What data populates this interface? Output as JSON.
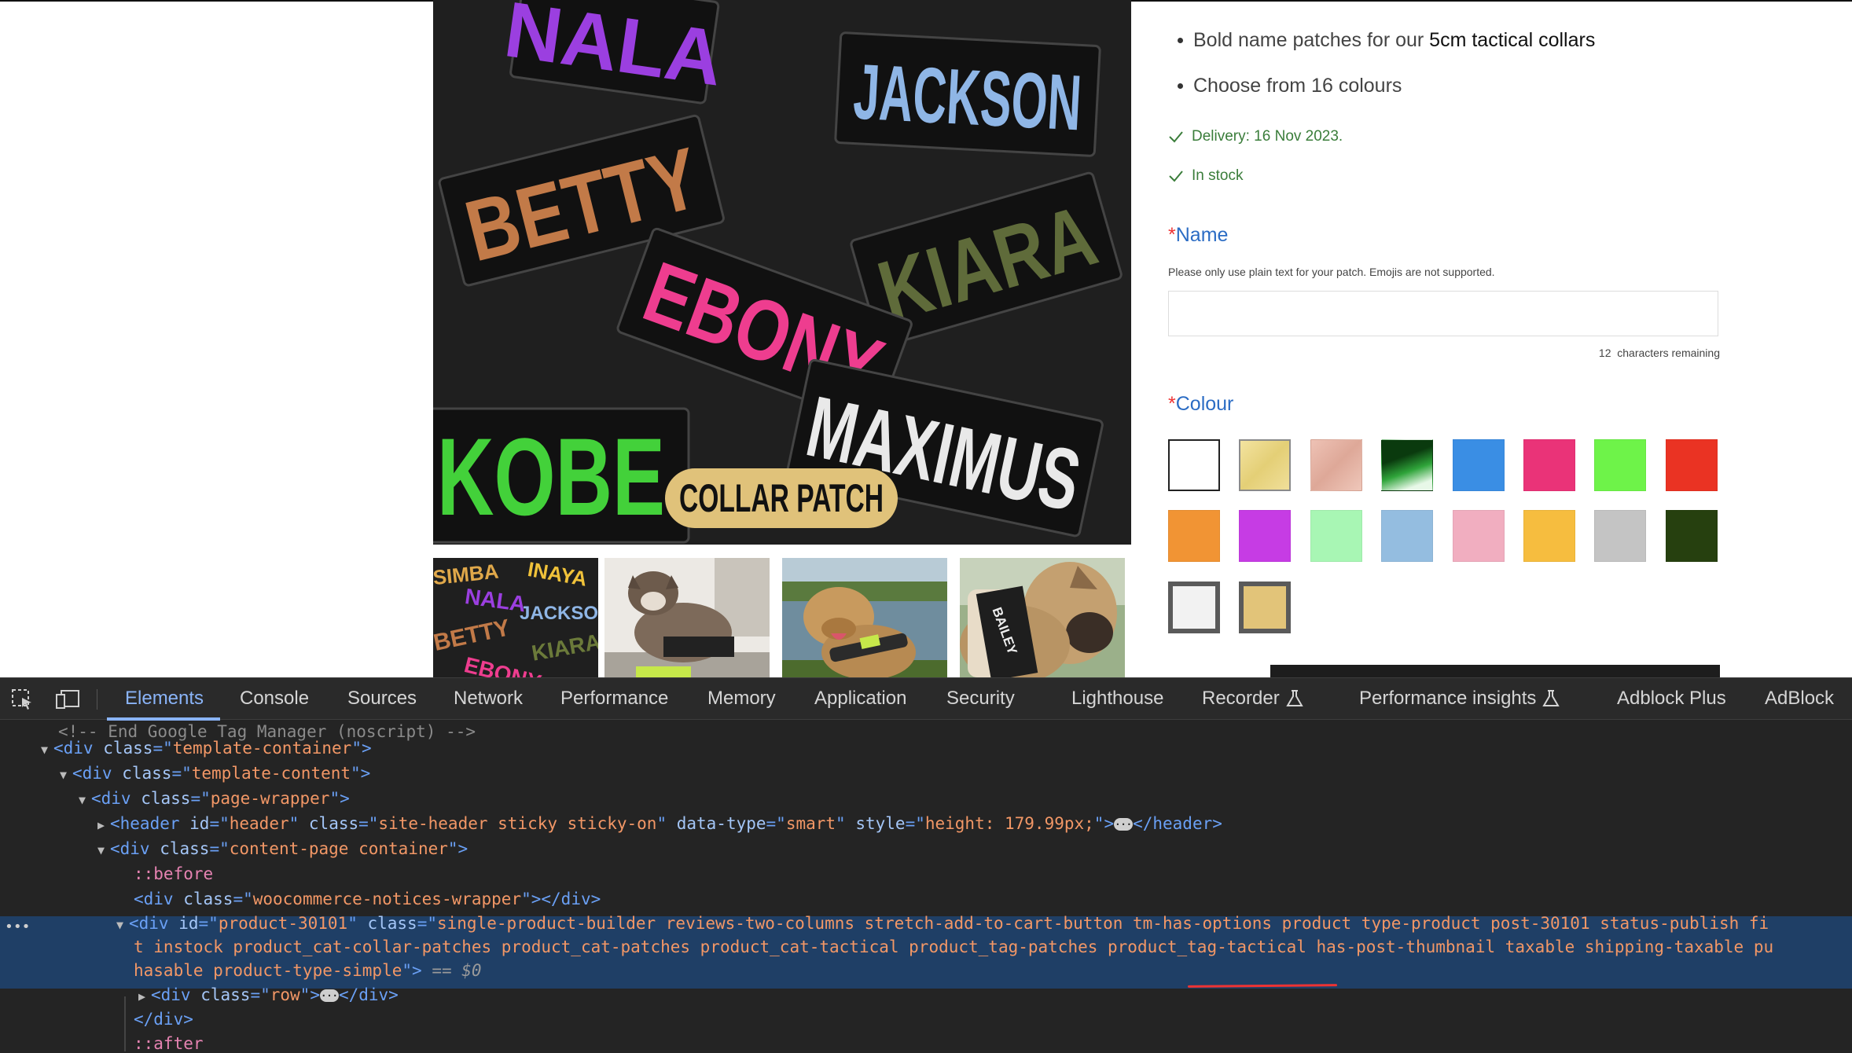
{
  "product": {
    "image": {
      "names": [
        "NALA",
        "JACKSON",
        "BETTY",
        "KIARA",
        "EBONY",
        "KOBE",
        "MAXIMUS"
      ],
      "badge": "COLLAR PATCH",
      "name_colors": {
        "NALA": "#9b3fe0",
        "JACKSON": "#8fb6e6",
        "BETTY": "#c27a48",
        "KIARA": "#5f6b3a",
        "EBONY": "#ee3d8f",
        "KOBE": "#43d13a",
        "MAXIMUS": "#e9e9e9"
      },
      "badge_color": "#e0c27a"
    },
    "thumbnails": [
      {
        "alt": "patch collage",
        "words": [
          "SIMBA",
          "INAYA",
          "NALA",
          "JACKSON",
          "BETTY",
          "KIARA",
          "EBONY"
        ]
      },
      {
        "alt": "dog in harness"
      },
      {
        "alt": "dog at lake with collar"
      },
      {
        "alt": "dog with named collar",
        "word": "BAILEY"
      }
    ]
  },
  "info": {
    "bullets": [
      {
        "prefix": "Bold name patches for our ",
        "strong": "5cm tactical collars"
      },
      {
        "prefix": "Choose from 16 colours",
        "strong": ""
      }
    ],
    "delivery": "Delivery: 16 Nov 2023.",
    "stock": "In stock",
    "name_field": {
      "required_mark": "*",
      "label": "Name",
      "hint": "Please only use plain text for your patch. Emojis are not supported.",
      "value": "",
      "remaining_count": "12",
      "remaining_text": "characters remaining"
    },
    "colour_field": {
      "required_mark": "*",
      "label": "Colour",
      "swatches": [
        {
          "name": "white",
          "color": "#ffffff",
          "selected": false
        },
        {
          "name": "gold",
          "color": "#ecd889",
          "selected": true
        },
        {
          "name": "rose-gold",
          "color": "#e8b7a8",
          "selected": false
        },
        {
          "name": "green-gradient",
          "color": "#0f4d14",
          "selected": false
        },
        {
          "name": "blue",
          "color": "#3a8ee4",
          "selected": false
        },
        {
          "name": "pink",
          "color": "#ea3378",
          "selected": false
        },
        {
          "name": "lime",
          "color": "#6ef349",
          "selected": false
        },
        {
          "name": "red",
          "color": "#ea3323",
          "selected": false
        },
        {
          "name": "orange",
          "color": "#f19434",
          "selected": false
        },
        {
          "name": "purple",
          "color": "#c63ce4",
          "selected": false
        },
        {
          "name": "mint",
          "color": "#a8f6b4",
          "selected": false
        },
        {
          "name": "light-blue",
          "color": "#94bde0",
          "selected": false
        },
        {
          "name": "light-pink",
          "color": "#f1aec0",
          "selected": false
        },
        {
          "name": "yellow",
          "color": "#f6bd3f",
          "selected": false
        },
        {
          "name": "grey",
          "color": "#c4c4c4",
          "selected": false
        },
        {
          "name": "dark-green",
          "color": "#26400f",
          "selected": false
        },
        {
          "name": "reflective-white",
          "color": "#f2f2f2",
          "selected": false
        },
        {
          "name": "reflective-gold",
          "color": "#e2c479",
          "selected": false
        }
      ]
    }
  },
  "devtools": {
    "tabs": [
      {
        "label": "Elements",
        "active": true
      },
      {
        "label": "Console",
        "active": false
      },
      {
        "label": "Sources",
        "active": false
      },
      {
        "label": "Network",
        "active": false
      },
      {
        "label": "Performance",
        "active": false
      },
      {
        "label": "Memory",
        "active": false
      },
      {
        "label": "Application",
        "active": false
      },
      {
        "label": "Security",
        "active": false
      },
      {
        "label": "Lighthouse",
        "active": false
      },
      {
        "label": "Recorder",
        "active": false,
        "flask": true
      },
      {
        "label": "Performance insights",
        "active": false,
        "flask": true
      },
      {
        "label": "Adblock Plus",
        "active": false
      },
      {
        "label": "AdBlock",
        "active": false
      }
    ],
    "tree": {
      "comment": "<!-- End Google Tag Manager (noscript) -->",
      "template_container_class": "template-container",
      "template_content_class": "template-content",
      "page_wrapper_class": "page-wrapper",
      "header": {
        "id": "header",
        "class": "site-header sticky sticky-on",
        "data_type": "smart",
        "style": "height: 179.99px;"
      },
      "content_page_class": "content-page container",
      "before": "::before",
      "notices_class": "woocommerce-notices-wrapper",
      "selected": {
        "id": "product-30101",
        "class_line1": "single-product-builder reviews-two-columns stretch-add-to-cart-button tm-has-options product type-product post-30101 status-publish fi",
        "class_line2": "t instock product_cat-collar-patches product_cat-patches product_cat-tactical product_tag-patches product_tag-tactical has-post-thumbnail taxable shipping-taxable pu",
        "class_line3": "hasable product-type-simple",
        "eq": "== $0"
      },
      "row_class": "row",
      "after": "::after"
    }
  }
}
